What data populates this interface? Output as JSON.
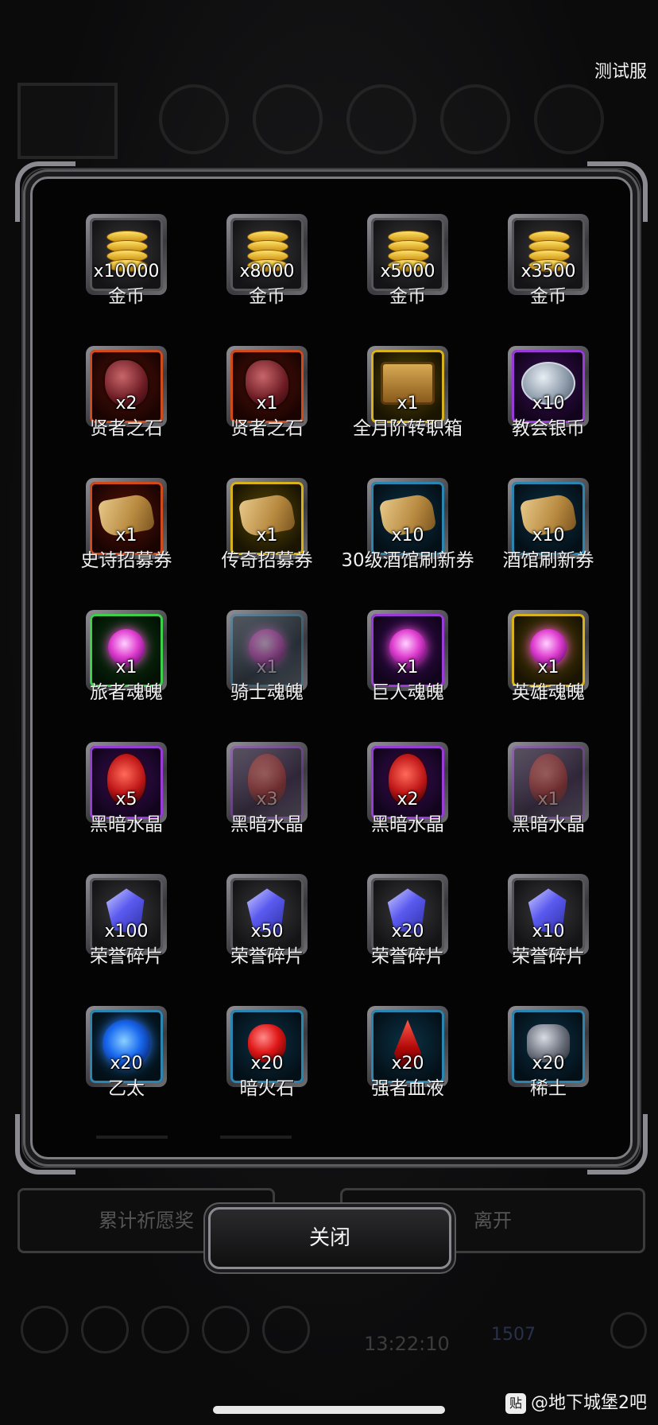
{
  "server_tag": "测试服",
  "background": {
    "wish_reward_button": "累计祈愿奖",
    "leave_button": "离开",
    "timer": "13:22:10",
    "currency_count": "1507"
  },
  "close_button": "关闭",
  "watermark": {
    "logo": "贴",
    "text": "@地下城堡2吧"
  },
  "items": [
    {
      "icon": "gold-coin-icon",
      "rarity": "gray",
      "qty": "x10000",
      "name": "金币",
      "dim": false
    },
    {
      "icon": "gold-coin-icon",
      "rarity": "gray",
      "qty": "x8000",
      "name": "金币",
      "dim": false
    },
    {
      "icon": "gold-coin-icon",
      "rarity": "gray",
      "qty": "x5000",
      "name": "金币",
      "dim": false
    },
    {
      "icon": "gold-coin-icon",
      "rarity": "gray",
      "qty": "x3500",
      "name": "金币",
      "dim": false
    },
    {
      "icon": "sage-stone-icon",
      "rarity": "red",
      "qty": "x2",
      "name": "贤者之石",
      "dim": false
    },
    {
      "icon": "sage-stone-icon",
      "rarity": "red",
      "qty": "x1",
      "name": "贤者之石",
      "dim": false
    },
    {
      "icon": "treasure-chest-icon",
      "rarity": "gold",
      "qty": "x1",
      "name": "全月阶转职箱",
      "dim": false
    },
    {
      "icon": "silver-coin-icon",
      "rarity": "purple",
      "qty": "x10",
      "name": "教会银币",
      "dim": false
    },
    {
      "icon": "scroll-icon",
      "rarity": "red",
      "qty": "x1",
      "name": "史诗招募券",
      "dim": false
    },
    {
      "icon": "scroll-icon",
      "rarity": "gold",
      "qty": "x1",
      "name": "传奇招募券",
      "dim": false
    },
    {
      "icon": "scroll-icon",
      "rarity": "blue",
      "qty": "x10",
      "name": "30级酒馆刷新券",
      "dim": false
    },
    {
      "icon": "scroll-icon",
      "rarity": "blue",
      "qty": "x10",
      "name": "酒馆刷新券",
      "dim": false
    },
    {
      "icon": "soul-orb-icon",
      "rarity": "green",
      "qty": "x1",
      "name": "旅者魂魄",
      "dim": false
    },
    {
      "icon": "soul-orb-icon",
      "rarity": "blue",
      "qty": "x1",
      "name": "骑士魂魄",
      "dim": true
    },
    {
      "icon": "soul-orb-icon",
      "rarity": "purple",
      "qty": "x1",
      "name": "巨人魂魄",
      "dim": false
    },
    {
      "icon": "soul-orb-icon",
      "rarity": "gold",
      "qty": "x1",
      "name": "英雄魂魄",
      "dim": false
    },
    {
      "icon": "dark-crystal-icon",
      "rarity": "purple",
      "qty": "x5",
      "name": "黑暗水晶",
      "dim": false
    },
    {
      "icon": "dark-crystal-icon",
      "rarity": "purple",
      "qty": "x3",
      "name": "黑暗水晶",
      "dim": true
    },
    {
      "icon": "dark-crystal-icon",
      "rarity": "purple",
      "qty": "x2",
      "name": "黑暗水晶",
      "dim": false
    },
    {
      "icon": "dark-crystal-icon",
      "rarity": "purple",
      "qty": "x1",
      "name": "黑暗水晶",
      "dim": true
    },
    {
      "icon": "honor-shard-icon",
      "rarity": "gray",
      "qty": "x100",
      "name": "荣誉碎片",
      "dim": false
    },
    {
      "icon": "honor-shard-icon",
      "rarity": "gray",
      "qty": "x50",
      "name": "荣誉碎片",
      "dim": false
    },
    {
      "icon": "honor-shard-icon",
      "rarity": "gray",
      "qty": "x20",
      "name": "荣誉碎片",
      "dim": false
    },
    {
      "icon": "honor-shard-icon",
      "rarity": "gray",
      "qty": "x10",
      "name": "荣誉碎片",
      "dim": false
    },
    {
      "icon": "ether-orb-icon",
      "rarity": "blue",
      "qty": "x20",
      "name": "乙太",
      "dim": false
    },
    {
      "icon": "dark-fire-stone-icon",
      "rarity": "blue",
      "qty": "x20",
      "name": "暗火石",
      "dim": false
    },
    {
      "icon": "blood-drop-icon",
      "rarity": "blue",
      "qty": "x20",
      "name": "强者血液",
      "dim": false
    },
    {
      "icon": "rare-earth-icon",
      "rarity": "blue",
      "qty": "x20",
      "name": "稀土",
      "dim": false
    }
  ]
}
